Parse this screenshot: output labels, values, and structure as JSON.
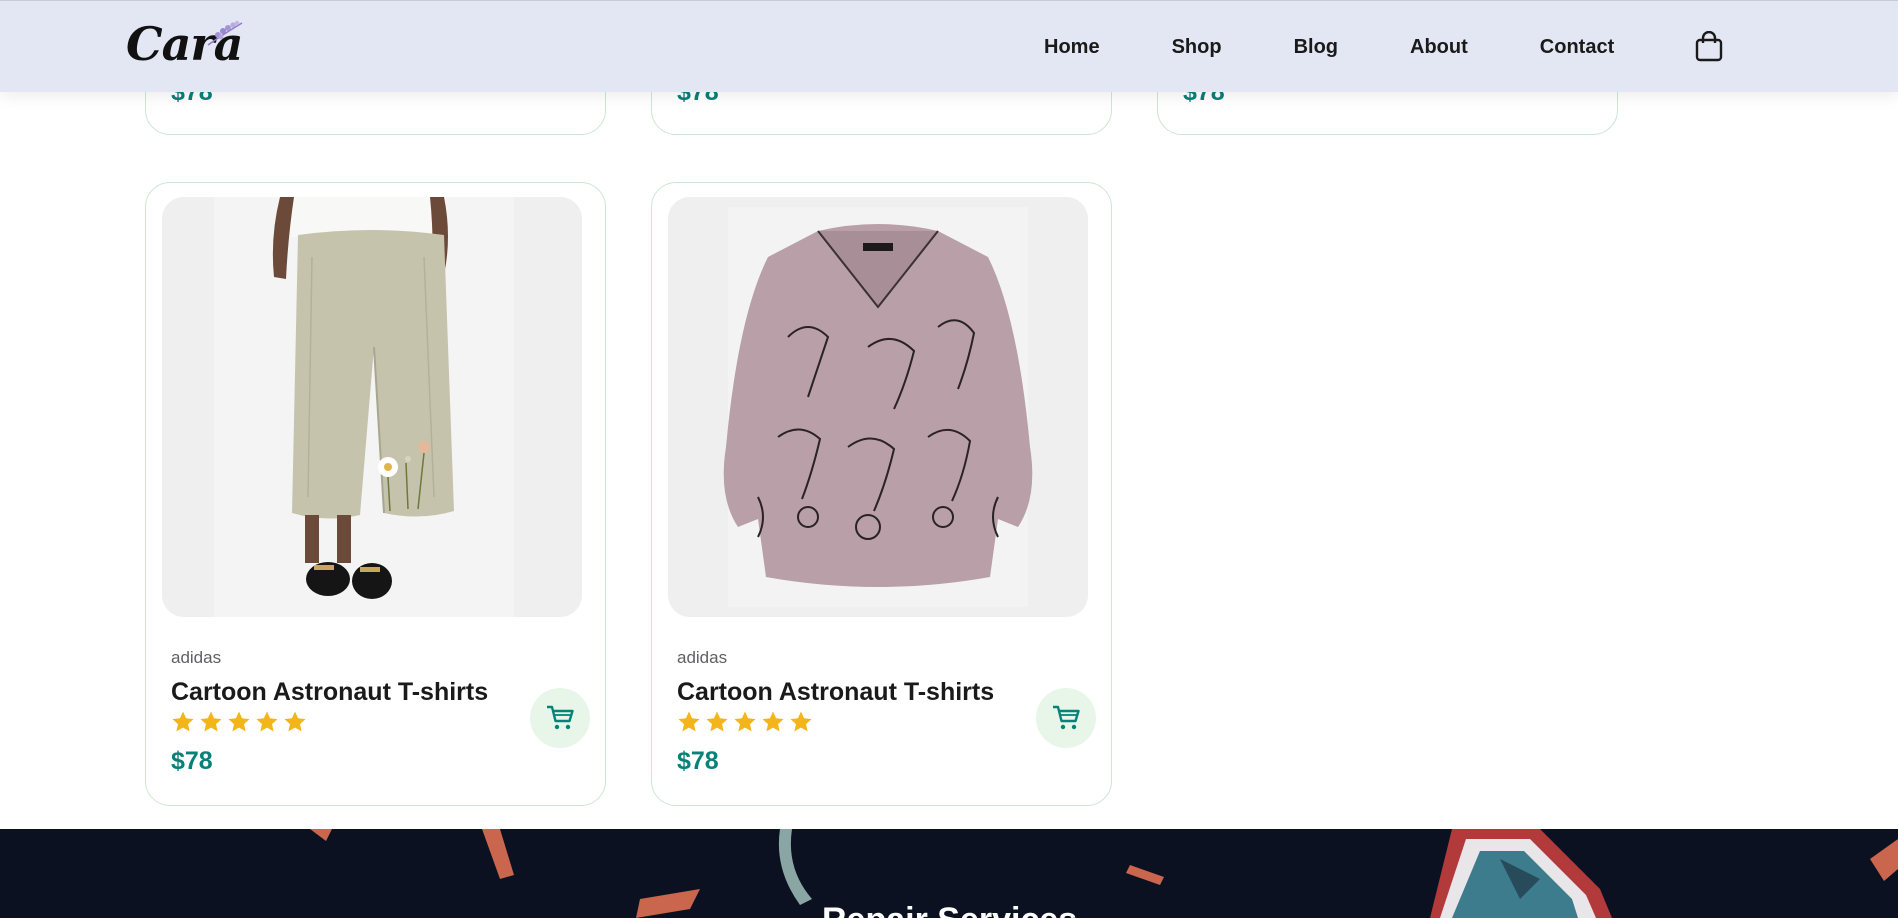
{
  "header": {
    "logo_text": "Cara",
    "nav": [
      "Home",
      "Shop",
      "Blog",
      "About",
      "Contact"
    ],
    "cart_icon": "shopping-bag-icon"
  },
  "top_row_prices": [
    "$78",
    "$78",
    "$78"
  ],
  "products": [
    {
      "brand": "adidas",
      "title": "Cartoon Astronaut T-shirts",
      "rating": 5,
      "price": "$78",
      "image": "linen-pants-photo"
    },
    {
      "brand": "adidas",
      "title": "Cartoon Astronaut T-shirts",
      "rating": 5,
      "price": "$78",
      "image": "cat-print-blouse-photo"
    }
  ],
  "banner": {
    "title": "Repair Services"
  },
  "colors": {
    "header_bg": "#e3e6f3",
    "price": "#088178",
    "star": "#f3b519",
    "cart_bg": "#e8f6ea",
    "banner_bg": "#0b1120"
  }
}
